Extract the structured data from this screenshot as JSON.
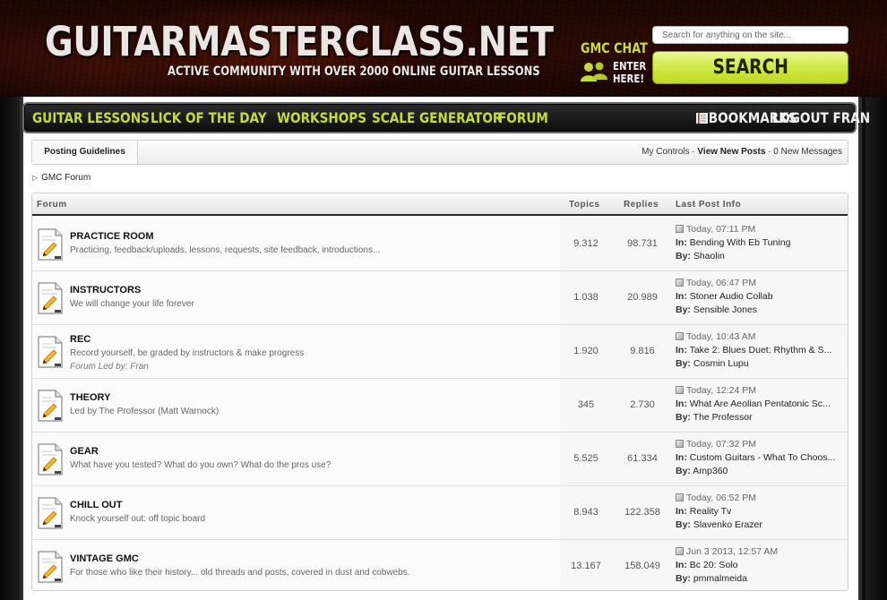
{
  "header": {
    "logo_title": "GUITARMASTERCLASS.NET",
    "logo_tagline": "ACTIVE COMMUNITY WITH OVER 2000 ONLINE GUITAR LESSONS",
    "chat_label": "GMC CHAT",
    "chat_enter_line1": "ENTER",
    "chat_enter_line2": "HERE!",
    "search_placeholder": "Search for anything on the site...",
    "search_button": "SEARCH",
    "accent_color": "#c5dc38"
  },
  "nav": {
    "items": [
      {
        "label": "GUITAR LESSONS"
      },
      {
        "label": "LICK OF THE DAY"
      },
      {
        "label": "WORKSHOPS"
      },
      {
        "label": "SCALE GENERATOR"
      },
      {
        "label": "FORUM"
      }
    ],
    "bookmarks": "BOOKMARKS",
    "logout": "LOGOUT FRAN"
  },
  "subnav": {
    "posting_guidelines": "Posting Guidelines",
    "my_controls": "My Controls",
    "view_new_posts": "View New Posts",
    "new_messages": "0 New Messages"
  },
  "breadcrumb": {
    "label": "GMC Forum"
  },
  "table": {
    "headers": {
      "forum": "Forum",
      "topics": "Topics",
      "replies": "Replies",
      "last_post": "Last Post Info"
    },
    "in_label": "In:",
    "by_label": "By:",
    "rows": [
      {
        "title": "PRACTICE ROOM",
        "desc": "Practicing, feedback/uploads, lessons, requests, site feedback, introductions...",
        "led": "",
        "topics": "9.312",
        "replies": "98.731",
        "date": "Today, 07:11 PM",
        "in": "Bending With Eb Tuning",
        "by": "Shaolin"
      },
      {
        "title": "INSTRUCTORS",
        "desc": "We will change your life forever",
        "led": "",
        "topics": "1.038",
        "replies": "20.989",
        "date": "Today, 06:47 PM",
        "in": "Stoner Audio Collab",
        "by": "Sensible Jones"
      },
      {
        "title": "REC",
        "desc": "Record yourself, be graded by instructors & make progress",
        "led": "Forum Led by: Fran",
        "topics": "1.920",
        "replies": "9.816",
        "date": "Today, 10:43 AM",
        "in": "Take 2: Blues Duet: Rhythm & S...",
        "by": "Cosmin Lupu"
      },
      {
        "title": "THEORY",
        "desc": "Led by The Professor (Matt Warnock)",
        "led": "",
        "topics": "345",
        "replies": "2.730",
        "date": "Today, 12:24 PM",
        "in": "What Are Aeolian Pentatonic Sc...",
        "by": "The Professor"
      },
      {
        "title": "GEAR",
        "desc": "What have you tested? What do you own? What do the pros use?",
        "led": "",
        "topics": "5.525",
        "replies": "61.334",
        "date": "Today, 07:32 PM",
        "in": "Custom Guitars - What To Choos...",
        "by": "Amp360"
      },
      {
        "title": "CHILL OUT",
        "desc": "Knock yourself out: off topic board",
        "led": "",
        "topics": "8.943",
        "replies": "122.358",
        "date": "Today, 06:52 PM",
        "in": "Reality Tv",
        "by": "Slavenko Erazer"
      },
      {
        "title": "VINTAGE GMC",
        "desc": "For those who like their history... old threads and posts, covered in dust and cobwebs.",
        "led": "",
        "topics": "13.167",
        "replies": "158.049",
        "date": "Jun 3 2013, 12:57 AM",
        "in": "Bc 20: Solo",
        "by": "pmmalmeida"
      }
    ]
  }
}
